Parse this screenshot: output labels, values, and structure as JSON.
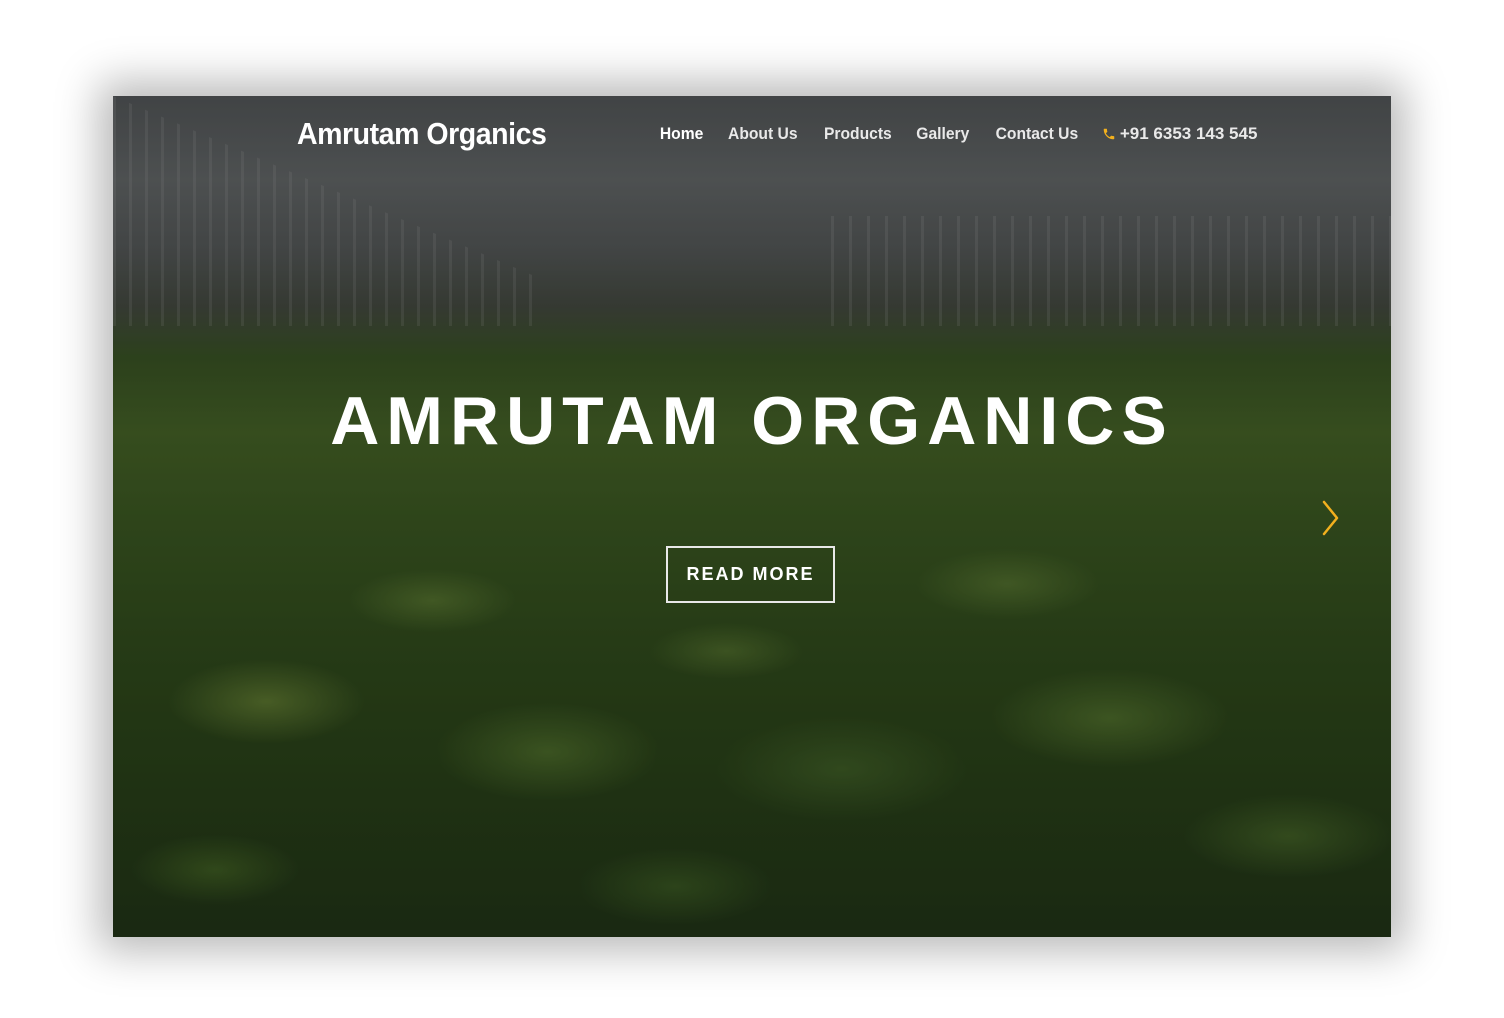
{
  "brand": {
    "name": "Amrutam Organics"
  },
  "nav": {
    "items": [
      {
        "label": "Home"
      },
      {
        "label": "About Us"
      },
      {
        "label": "Products"
      },
      {
        "label": "Gallery"
      },
      {
        "label": "Contact Us"
      }
    ],
    "active": "Home",
    "phone": "+91 6353 143 545"
  },
  "hero": {
    "headline": "AMRUTAM ORGANICS",
    "button_label": "READ MORE"
  },
  "icons": {
    "phone": "phone-icon",
    "next": "chevron-right-icon"
  },
  "colors": {
    "accent": "#f2b01e",
    "text": "#ffffff"
  }
}
